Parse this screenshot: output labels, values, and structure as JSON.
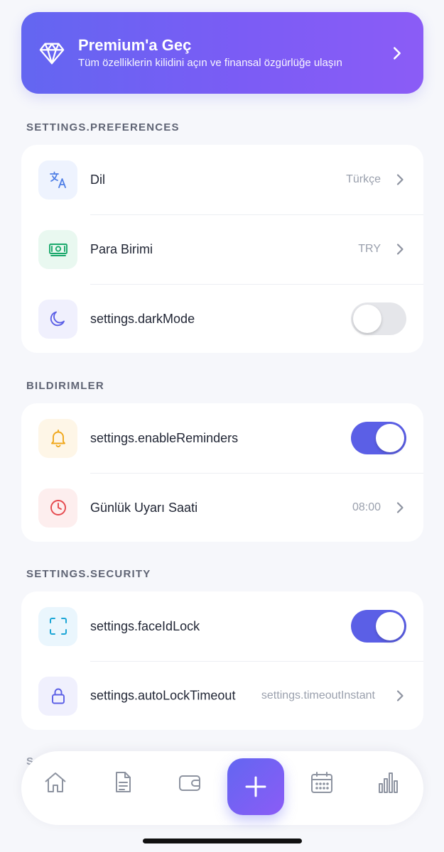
{
  "premium": {
    "title": "Premium'a Geç",
    "subtitle": "Tüm özelliklerin kilidini açın ve finansal özgürlüğe ulaşın",
    "icon": "diamond-icon"
  },
  "sections": {
    "preferences": {
      "title": "SETTINGS.PREFERENCES",
      "language": {
        "label": "Dil",
        "value": "Türkçe",
        "icon": "translate-icon"
      },
      "currency": {
        "label": "Para Birimi",
        "value": "TRY",
        "icon": "banknote-icon"
      },
      "dark_mode": {
        "label": "settings.darkMode",
        "enabled": false,
        "icon": "moon-icon"
      }
    },
    "notifications": {
      "title": "BILDIRIMLER",
      "reminders": {
        "label": "settings.enableReminders",
        "enabled": true,
        "icon": "bell-icon"
      },
      "daily_alert": {
        "label": "Günlük Uyarı Saati",
        "value": "08:00",
        "icon": "clock-icon"
      }
    },
    "security": {
      "title": "SETTINGS.SECURITY",
      "face_id": {
        "label": "settings.faceIdLock",
        "enabled": true,
        "icon": "face-scan-icon"
      },
      "auto_lock": {
        "label": "settings.autoLockTimeout",
        "value": "settings.timeoutInstant",
        "icon": "lock-icon"
      }
    }
  },
  "colors": {
    "accent": "#5b5fe6",
    "premium_gradient_start": "#6366f1",
    "premium_gradient_end": "#8b5cf6"
  },
  "tabbar": {
    "tabs": [
      "home-icon",
      "document-icon",
      "wallet-icon",
      "add-icon",
      "calendar-icon",
      "chart-icon"
    ]
  }
}
